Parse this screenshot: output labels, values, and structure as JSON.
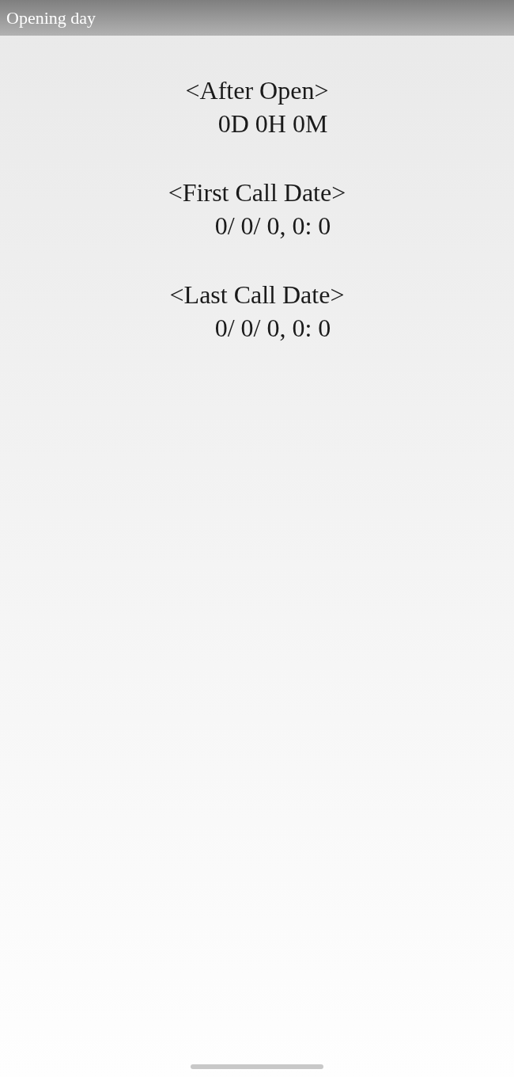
{
  "title_bar": {
    "title": "Opening day"
  },
  "sections": [
    {
      "heading": "<After Open>",
      "value": "0D 0H 0M"
    },
    {
      "heading": "<First Call Date>",
      "value": "0/ 0/ 0, 0: 0"
    },
    {
      "heading": "<Last Call Date>",
      "value": "0/ 0/ 0, 0: 0"
    }
  ]
}
